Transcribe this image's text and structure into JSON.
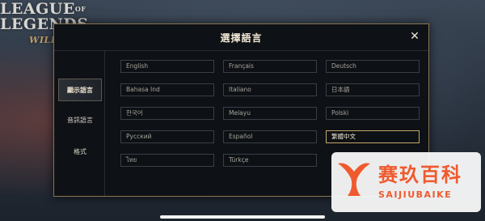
{
  "background": {
    "logo_line1": "LEAGUE",
    "logo_of": "OF",
    "logo_line2": "LEGENDS",
    "logo_tag": "WILD RIFT"
  },
  "modal": {
    "title": "選擇語言",
    "close_label": "✕"
  },
  "sidebar": {
    "items": [
      {
        "label": "顯示語言",
        "active": true
      },
      {
        "label": "音訊語言",
        "active": false
      },
      {
        "label": "格式",
        "active": false
      }
    ]
  },
  "languages": [
    {
      "label": "English"
    },
    {
      "label": "Français"
    },
    {
      "label": "Deutsch"
    },
    {
      "label": "Bahasa Ind"
    },
    {
      "label": "Italiano"
    },
    {
      "label": "日本語"
    },
    {
      "label": "한국어"
    },
    {
      "label": "Melayu"
    },
    {
      "label": "Polski"
    },
    {
      "label": "Русский"
    },
    {
      "label": "Español"
    },
    {
      "label": "繁體中文",
      "selected": true
    },
    {
      "label": "ไทย"
    },
    {
      "label": "Türkçe"
    }
  ],
  "watermark": {
    "cn": "赛玖百科",
    "en": "SAIJIUBAIKE"
  },
  "colors": {
    "accent_gold": "#c7a86a",
    "brand_orange": "#ef5a2e"
  }
}
